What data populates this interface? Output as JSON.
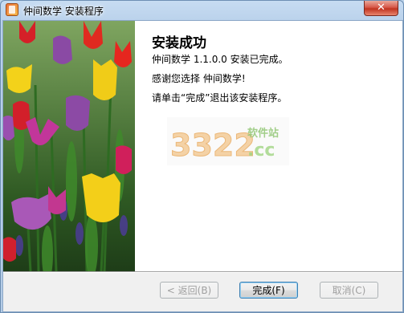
{
  "window": {
    "title": "仲间数学 安装程序",
    "close_glyph": "✕"
  },
  "content": {
    "heading": "安装成功",
    "lines": [
      "仲间数学 1.1.0.0 安装已完成。",
      "感谢您选择 仲间数学!",
      "请单击“完成”退出该安装程序。"
    ]
  },
  "watermark": {
    "digits": "3322",
    "site_cn": "软件站",
    "domain": ".cc"
  },
  "buttons": {
    "back": "< 返回(B)",
    "finish": "完成(F)",
    "cancel": "取消(C)"
  },
  "colors": {
    "title_bar": "#b9d1ea",
    "panel": "#ffffff",
    "client": "#f0f0f0",
    "close": "#c7402d"
  }
}
